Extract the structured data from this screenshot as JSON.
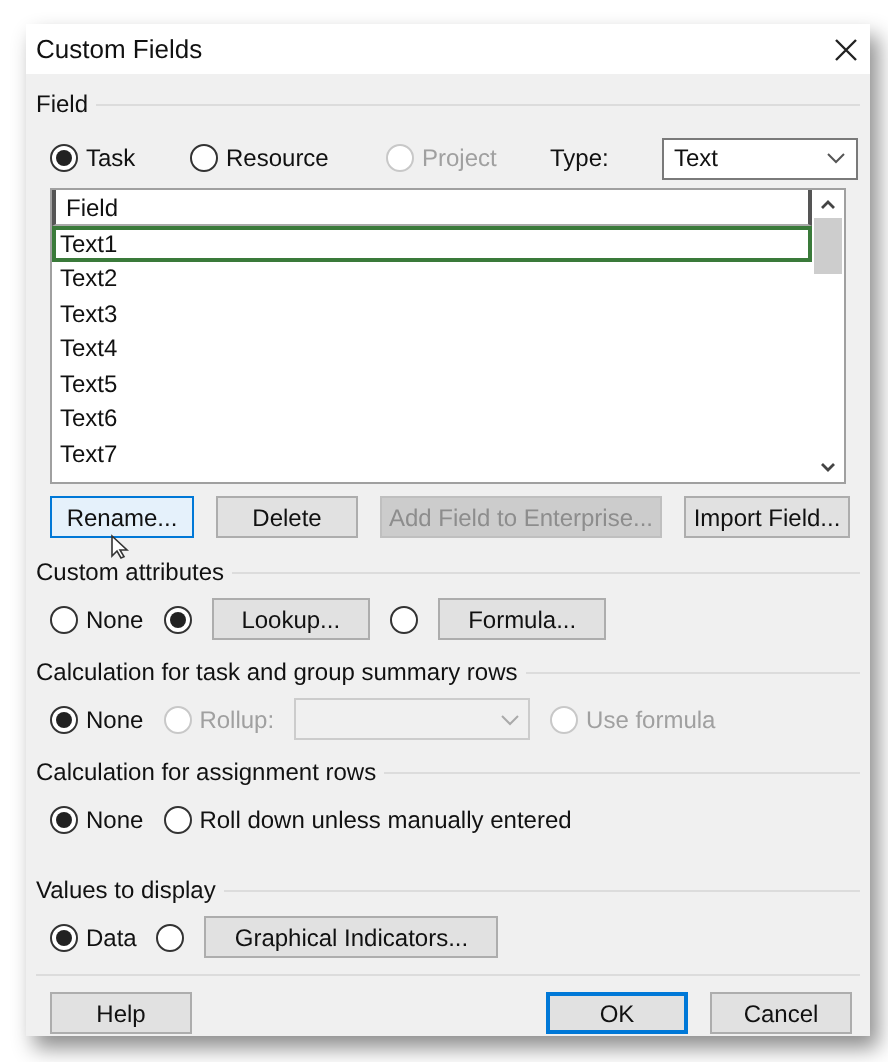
{
  "window": {
    "title": "Custom Fields"
  },
  "field_section": {
    "label": "Field",
    "options": [
      {
        "label": "Task",
        "selected": true,
        "disabled": false
      },
      {
        "label": "Resource",
        "selected": false,
        "disabled": false
      },
      {
        "label": "Project",
        "selected": false,
        "disabled": true
      }
    ],
    "type_label": "Type:",
    "type_value": "Text"
  },
  "field_list": {
    "header": "Field",
    "rows": [
      {
        "label": "Text1",
        "selected": true
      },
      {
        "label": "Text2",
        "selected": false
      },
      {
        "label": "Text3",
        "selected": false
      },
      {
        "label": "Text4",
        "selected": false
      },
      {
        "label": "Text5",
        "selected": false
      },
      {
        "label": "Text6",
        "selected": false
      },
      {
        "label": "Text7",
        "selected": false
      }
    ]
  },
  "list_buttons": [
    {
      "label": "Rename...",
      "disabled": false,
      "highlighted": true
    },
    {
      "label": "Delete",
      "disabled": false,
      "highlighted": false
    },
    {
      "label": "Add Field to Enterprise...",
      "disabled": true,
      "highlighted": false
    },
    {
      "label": "Import Field...",
      "disabled": false,
      "highlighted": false
    }
  ],
  "groups": [
    {
      "label": "Custom attributes",
      "items": [
        {
          "kind": "radio",
          "label": "None",
          "selected": false,
          "disabled": false
        },
        {
          "kind": "radio",
          "selected": true,
          "disabled": false
        },
        {
          "kind": "button",
          "label": "Lookup..."
        },
        {
          "kind": "radio",
          "selected": false,
          "disabled": false
        },
        {
          "kind": "button",
          "label": "Formula..."
        }
      ]
    },
    {
      "label": "Calculation for task and group summary rows",
      "items": [
        {
          "kind": "radio",
          "label": "None",
          "selected": true,
          "disabled": false
        },
        {
          "kind": "radio",
          "label": "Rollup:",
          "selected": false,
          "disabled": true
        },
        {
          "kind": "dropdown",
          "disabled": true
        },
        {
          "kind": "radio",
          "label": "Use formula",
          "selected": false,
          "disabled": true
        }
      ]
    },
    {
      "label": "Calculation for assignment rows",
      "items": [
        {
          "kind": "radio",
          "label": "None",
          "selected": true,
          "disabled": false
        },
        {
          "kind": "radio",
          "label": "Roll down unless manually entered",
          "selected": false,
          "disabled": false
        }
      ]
    },
    {
      "label": "Values to display",
      "items": [
        {
          "kind": "radio",
          "label": "Data",
          "selected": true,
          "disabled": false
        },
        {
          "kind": "radio",
          "selected": false,
          "disabled": false
        },
        {
          "kind": "button",
          "label": "Graphical Indicators..."
        }
      ]
    }
  ],
  "footer_buttons": [
    {
      "label": "Help",
      "focused": false
    },
    {
      "label": "OK",
      "focused": true
    },
    {
      "label": "Cancel",
      "focused": false
    }
  ]
}
